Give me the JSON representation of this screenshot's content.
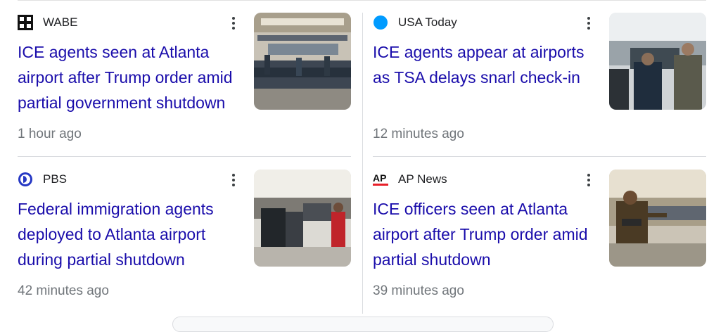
{
  "articles": [
    {
      "source": "WABE",
      "source_icon": "wabe-logo-icon",
      "headline": "ICE agents seen at Atlanta airport after Trump order amid partial government shutdown",
      "time": "1 hour ago",
      "thumbnail": "airport-concourse-crowd-photo"
    },
    {
      "source": "USA Today",
      "source_icon": "usa-today-dot-icon",
      "headline": "ICE agents appear at airports as TSA delays snarl check-in",
      "time": "12 minutes ago",
      "thumbnail": "agents-in-airport-photo"
    },
    {
      "source": "PBS",
      "source_icon": "pbs-logo-icon",
      "headline": "Federal immigration agents deployed to Atlanta airport during partial shutdown",
      "time": "42 minutes ago",
      "thumbnail": "security-line-crowd-photo"
    },
    {
      "source": "AP News",
      "source_icon": "ap-logo-icon",
      "headline": "ICE officers seen at Atlanta airport after Trump order amid partial shutdown",
      "time": "39 minutes ago",
      "thumbnail": "police-officer-airport-photo"
    }
  ],
  "colors": {
    "headline": "#1a0dab",
    "time": "#70757a",
    "source": "#202124",
    "divider": "#dadce0",
    "usa_today_blue": "#009bff",
    "ap_red": "#e8202a"
  }
}
